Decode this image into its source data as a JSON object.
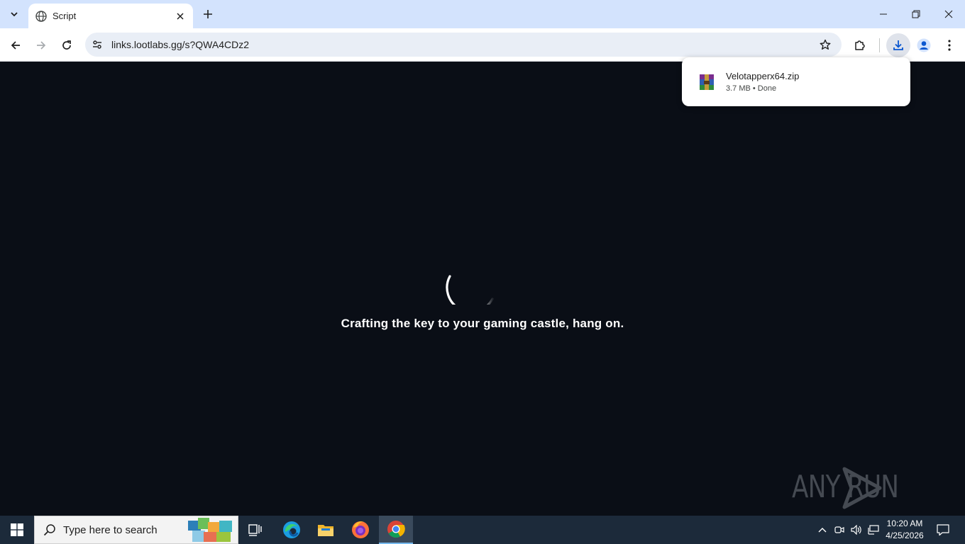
{
  "browser": {
    "tab": {
      "title": "Script"
    },
    "address_bar": {
      "url": "links.lootlabs.gg/s?QWA4CDz2"
    }
  },
  "page": {
    "loading_text": "Crafting the key to your gaming castle, hang on.",
    "watermark": "ANY RUN"
  },
  "download_bubble": {
    "file_name": "Velotapperx64.zip",
    "meta": "3.7 MB • Done",
    "icon": "winrar-archive-icon"
  },
  "taskbar": {
    "search_placeholder": "Type here to search",
    "apps": [
      "task-view",
      "edge",
      "file-explorer",
      "firefox",
      "chrome"
    ],
    "active_app": "chrome",
    "clock": {
      "time": "10:20 AM",
      "date": "4/25/2026"
    }
  },
  "colors": {
    "tabstrip": "#d3e3fd",
    "page_background": "#0a0e16",
    "taskbar": "#1c2a3a",
    "accent": "#0b57d0"
  }
}
